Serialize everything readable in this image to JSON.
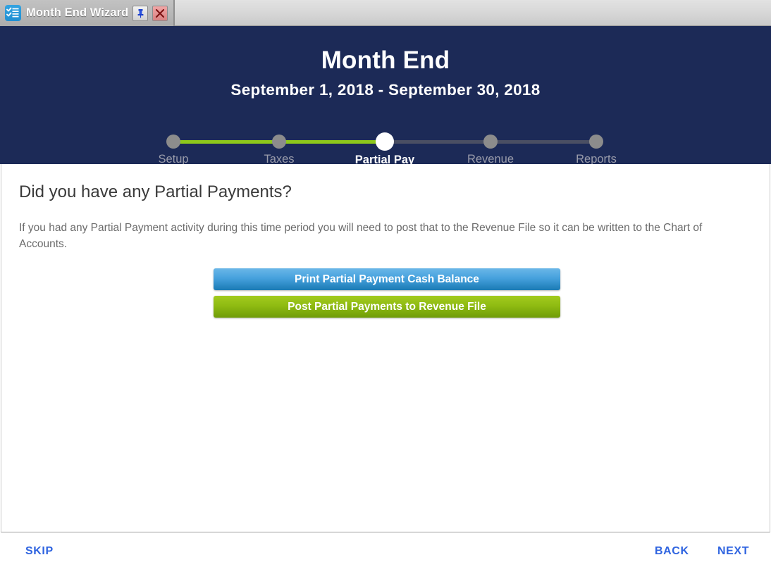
{
  "titlebar": {
    "app_icon": "checklist-icon",
    "title": "Month End Wizard",
    "pin_icon": "pushpin-icon",
    "close_icon": "close-x-icon"
  },
  "header": {
    "title": "Month End",
    "date_range": "September 1, 2018  -  September 30, 2018",
    "background_color": "#1c2a57",
    "progress_done_color": "#8dc81b",
    "progress_todo_color": "#4a4f63"
  },
  "stepper": {
    "current_index": 2,
    "steps": [
      {
        "label": "Setup",
        "state": "done"
      },
      {
        "label": "Taxes",
        "state": "done"
      },
      {
        "label": "Partial Pay",
        "state": "current"
      },
      {
        "label": "Revenue",
        "state": "todo"
      },
      {
        "label": "Reports",
        "state": "todo"
      }
    ]
  },
  "content": {
    "heading": "Did you have any Partial Payments?",
    "body": "If you had any Partial Payment activity during this time period you will need to post that to the Revenue File so it can be written to the Chart of Accounts.",
    "actions": [
      {
        "label": "Print Partial Payment Cash Balance",
        "color": "#46a1dd"
      },
      {
        "label": "Post Partial Payments to Revenue File",
        "color": "#8fbb12"
      }
    ]
  },
  "footer": {
    "skip_label": "SKIP",
    "back_label": "BACK",
    "next_label": "NEXT",
    "link_color": "#2f64e0"
  }
}
